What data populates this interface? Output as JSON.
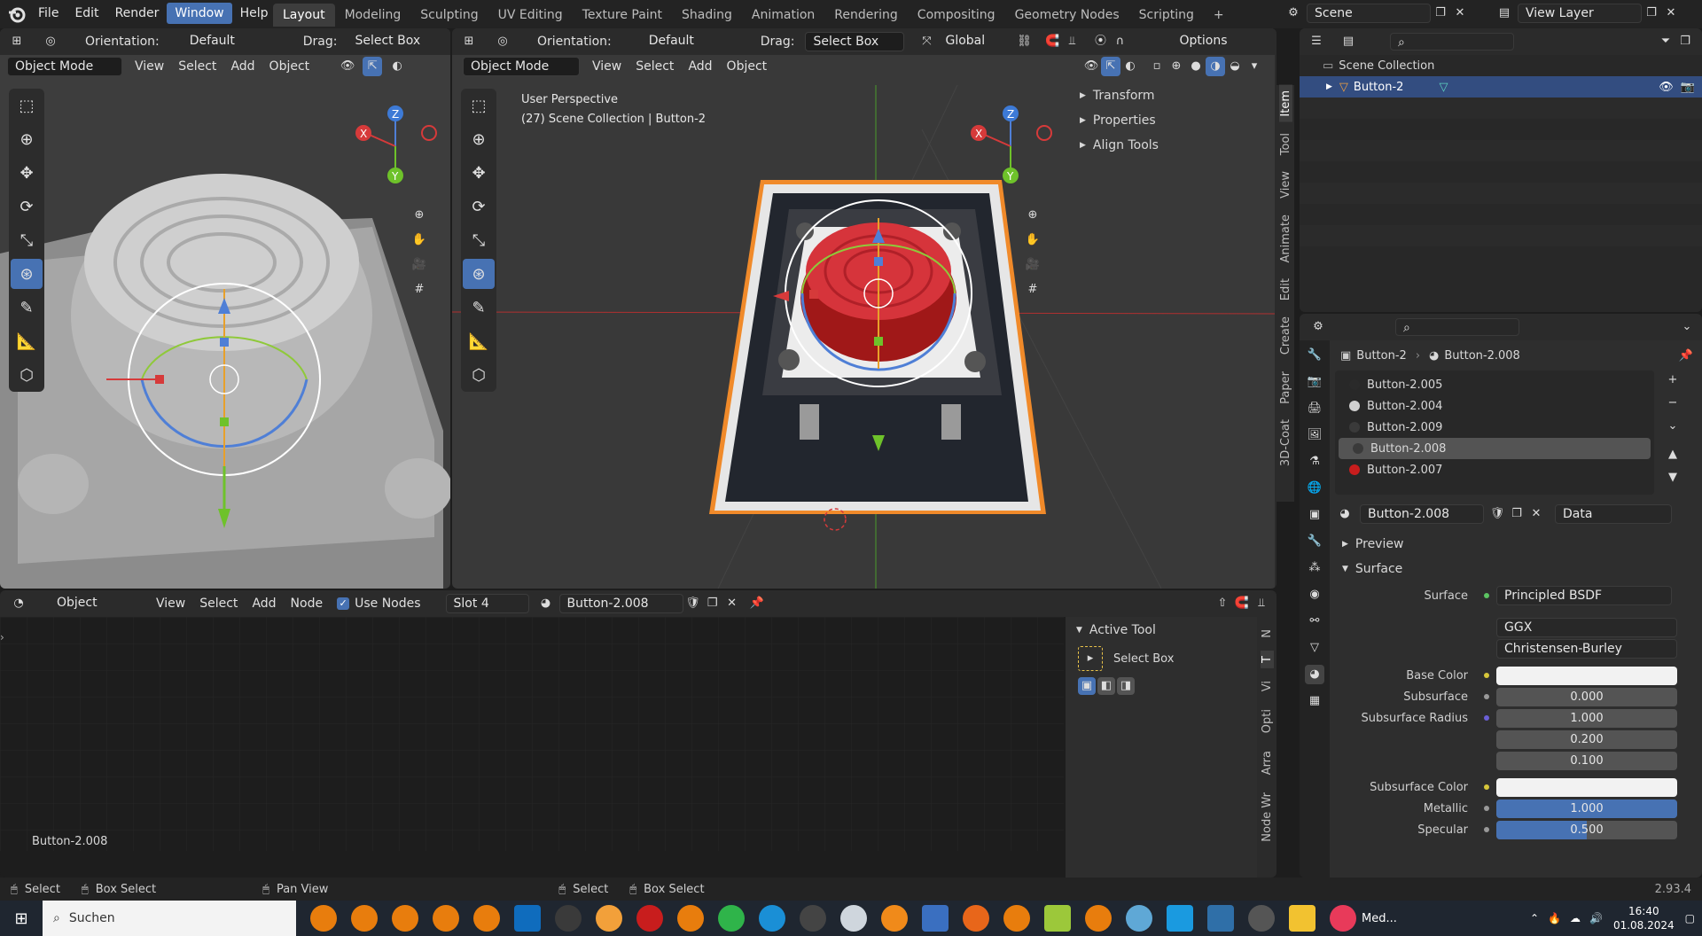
{
  "app": {
    "menu": [
      "File",
      "Edit",
      "Render",
      "Window",
      "Help"
    ],
    "active_menu": "Window"
  },
  "workspaces": [
    "Layout",
    "Modeling",
    "Sculpting",
    "UV Editing",
    "Texture Paint",
    "Shading",
    "Animation",
    "Rendering",
    "Compositing",
    "Geometry Nodes",
    "Scripting"
  ],
  "active_workspace": "Layout",
  "scene": {
    "name": "Scene",
    "view_layer": "View Layer"
  },
  "viewport_left": {
    "orientation_label": "Orientation:",
    "orientation": "Default",
    "drag_label": "Drag:",
    "drag": "Select Box",
    "mode": "Object Mode",
    "menus": [
      "View",
      "Select",
      "Add",
      "Object"
    ]
  },
  "viewport_main": {
    "orientation_label": "Orientation:",
    "orientation": "Default",
    "drag_label": "Drag:",
    "drag": "Select Box",
    "transform": "Global",
    "options": "Options",
    "mode": "Object Mode",
    "menus": [
      "View",
      "Select",
      "Add",
      "Object"
    ],
    "perspective": "User Perspective",
    "collection_info": "(27) Scene Collection | Button-2",
    "npanel": [
      "Transform",
      "Properties",
      "Align Tools"
    ],
    "sidetabs": [
      "Item",
      "Tool",
      "View",
      "Animate",
      "Edit",
      "Create",
      "Paper",
      "3D-Coat"
    ]
  },
  "outliner": {
    "root": "Scene Collection",
    "item": "Button-2"
  },
  "properties": {
    "breadcrumb_object": "Button-2",
    "breadcrumb_material": "Button-2.008",
    "slots": [
      "Button-2.005",
      "Button-2.004",
      "Button-2.009",
      "Button-2.008",
      "Button-2.007"
    ],
    "slot_colors": [
      "#2a2a2a",
      "#d0d0d0",
      "#3a3a3a",
      "#3a3a3a",
      "#c81d1d"
    ],
    "selected_slot": 3,
    "material_name": "Button-2.008",
    "link": "Data",
    "preview": "Preview",
    "surface_panel": "Surface",
    "surface_label": "Surface",
    "surface": "Principled BSDF",
    "distribution": "GGX",
    "subsurface_method": "Christensen-Burley",
    "base_color_label": "Base Color",
    "subsurface_label": "Subsurface",
    "subsurface": "0.000",
    "subsurface_radius_label": "Subsurface Radius",
    "subsurface_radius": [
      "1.000",
      "0.200",
      "0.100"
    ],
    "subsurface_color_label": "Subsurface Color",
    "metallic_label": "Metallic",
    "metallic": "1.000",
    "metallic_fill": 1.0,
    "specular_label": "Specular",
    "specular": "0.500",
    "specular_fill": 0.5
  },
  "node_editor": {
    "type": "Object",
    "menus": [
      "View",
      "Select",
      "Add",
      "Node"
    ],
    "use_nodes": "Use Nodes",
    "slot": "Slot 4",
    "material": "Button-2.008",
    "active_tool_title": "Active Tool",
    "active_tool": "Select Box",
    "footer_label": "Button-2.008",
    "sidetabs": [
      "N",
      "T",
      "Vi",
      "Opti",
      "Arra",
      "Node Wr"
    ]
  },
  "statusbar": {
    "items": [
      "Select",
      "Box Select",
      "Pan View",
      "Select",
      "Box Select"
    ],
    "version": "2.93.4"
  },
  "taskbar": {
    "search": "Suchen",
    "app_label": "Med...",
    "time": "16:40",
    "date": "01.08.2024"
  }
}
